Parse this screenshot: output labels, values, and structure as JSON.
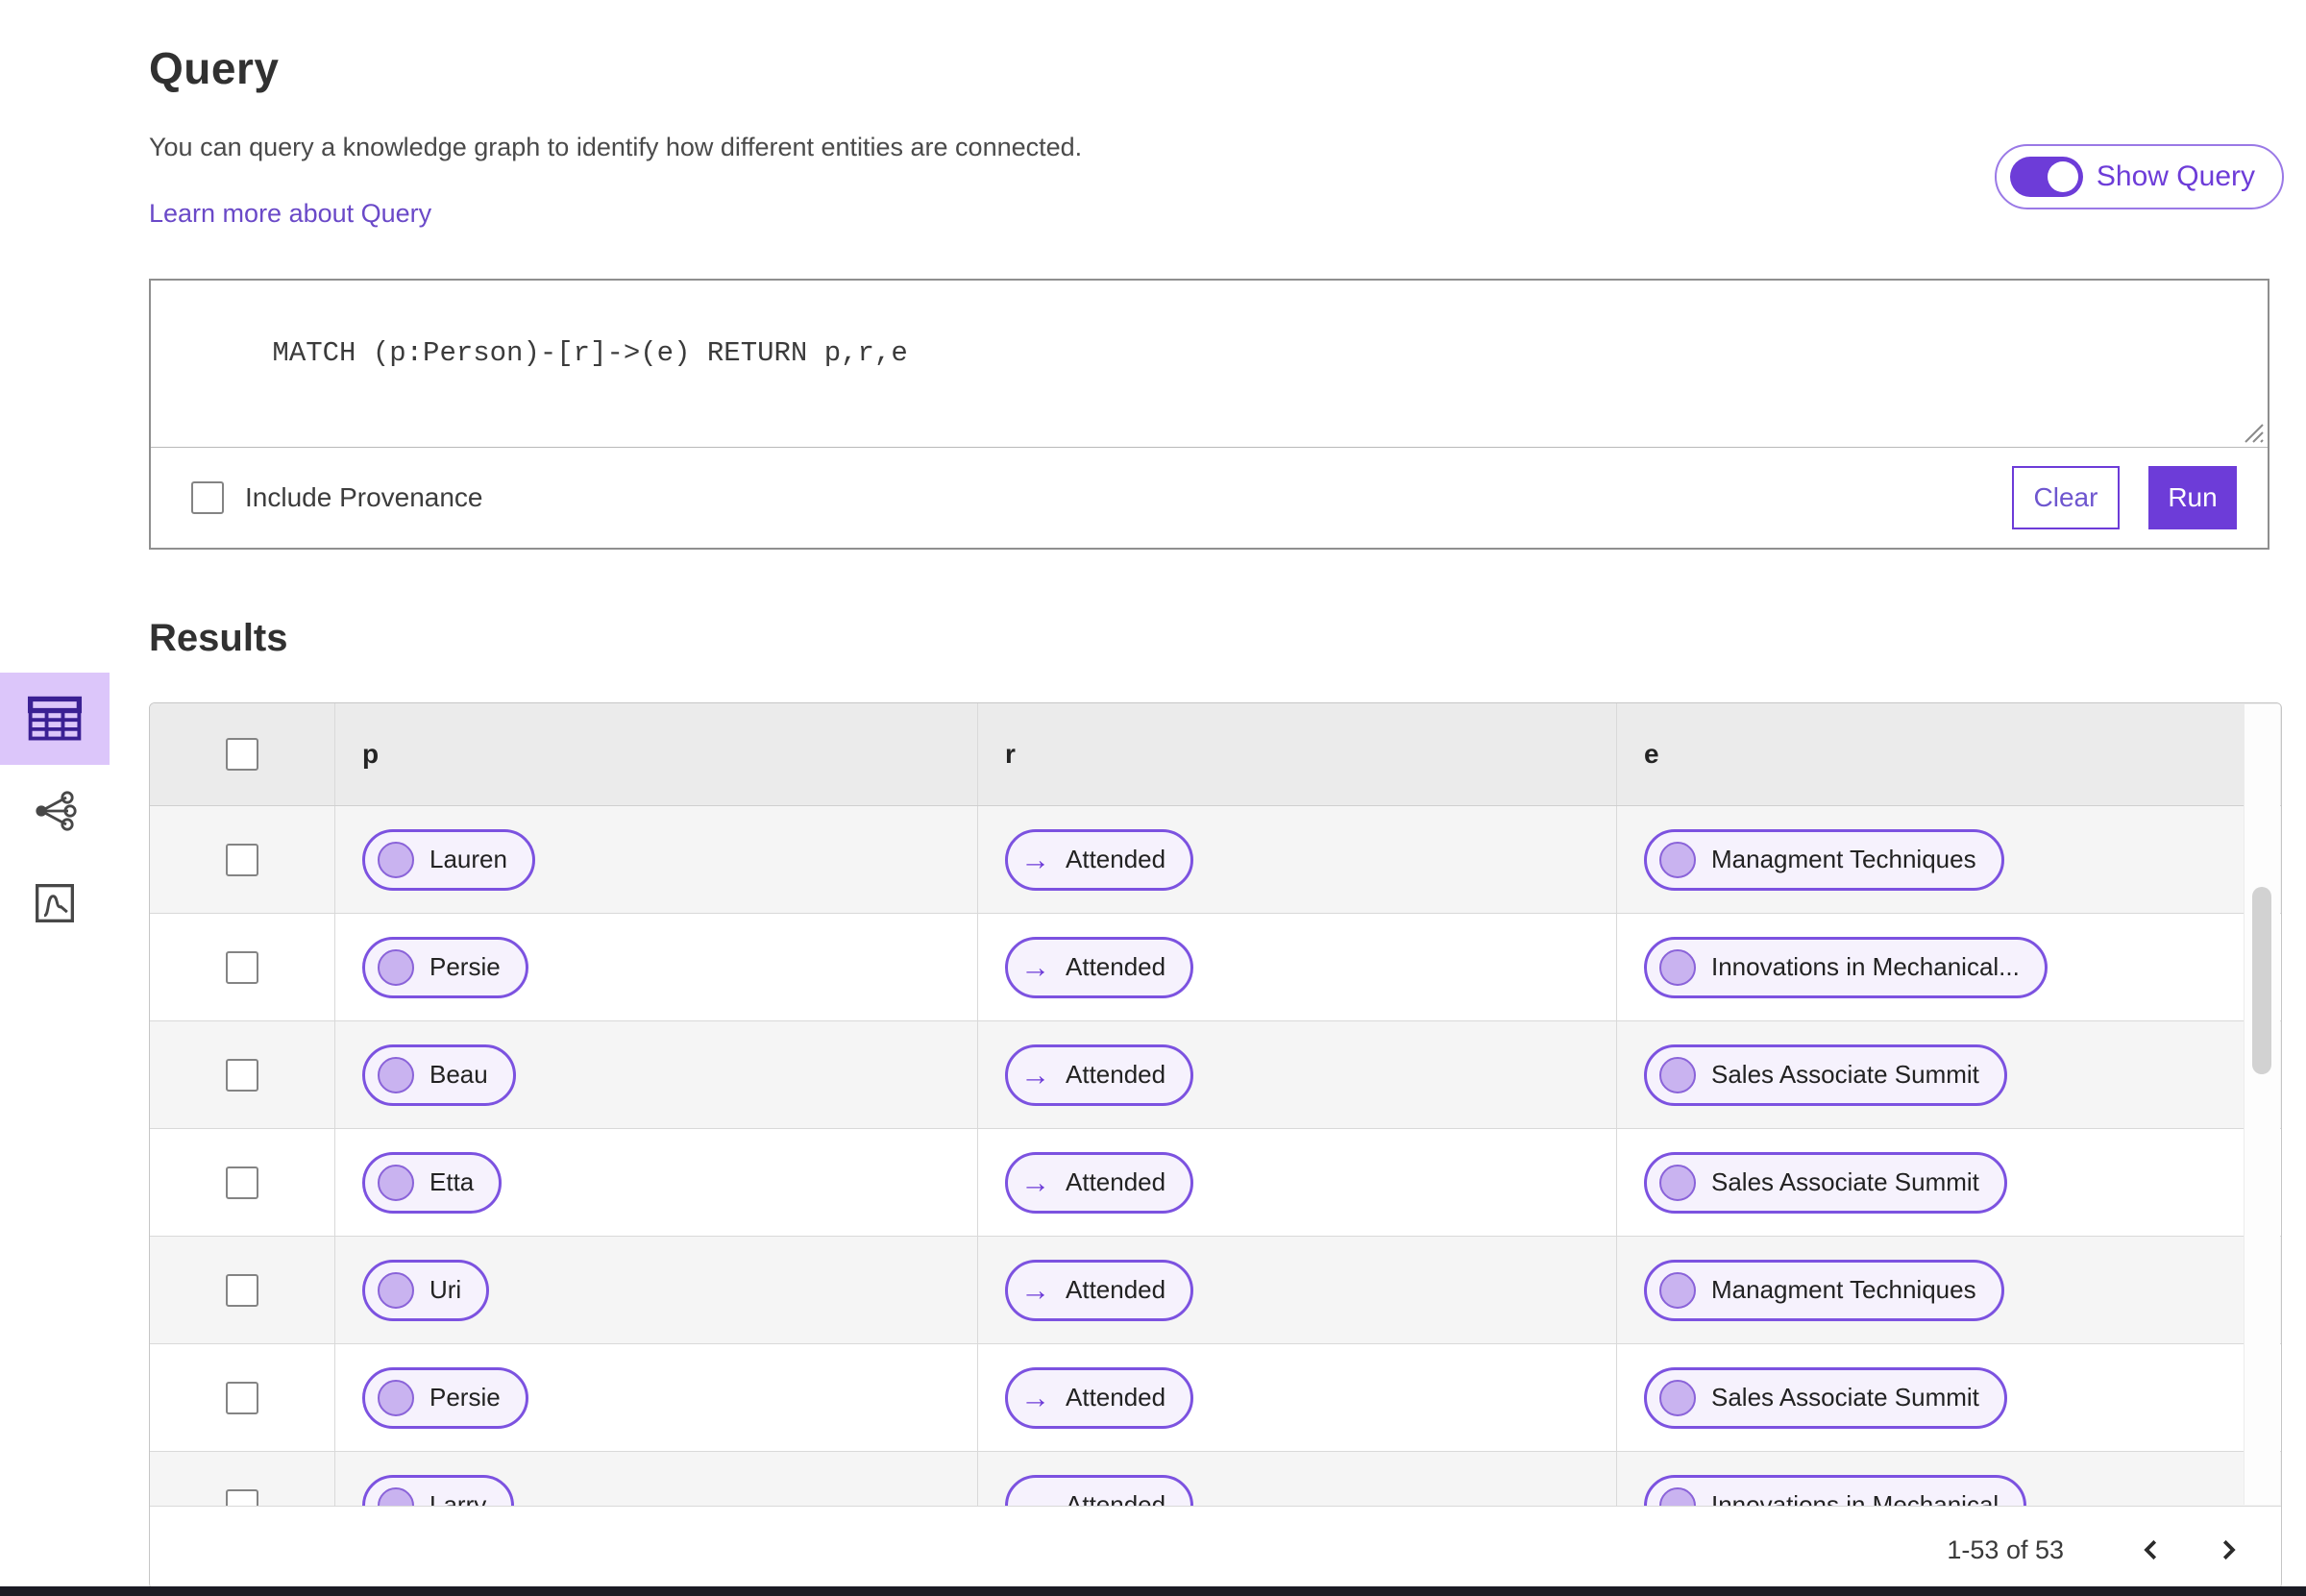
{
  "header": {
    "title": "Query",
    "description": "You can query a knowledge graph to identify how different entities are connected.",
    "learn_more_link": "Learn more about Query",
    "show_query_toggle": {
      "label": "Show Query",
      "state": "on"
    }
  },
  "query_editor": {
    "query_text": "MATCH (p:Person)-[r]->(e) RETURN p,r,e",
    "include_provenance": {
      "label": "Include Provenance",
      "checked": false
    },
    "clear_button": "Clear",
    "run_button": "Run"
  },
  "results": {
    "title": "Results",
    "view_switcher": [
      {
        "id": "table-view",
        "icon": "table-icon",
        "selected": true
      },
      {
        "id": "graph-view",
        "icon": "graph-icon",
        "selected": false
      },
      {
        "id": "chart-view",
        "icon": "chart-icon",
        "selected": false
      }
    ],
    "table": {
      "columns": [
        "p",
        "r",
        "e"
      ],
      "rows": [
        {
          "p": "Lauren",
          "r": "Attended",
          "e": "Managment Techniques"
        },
        {
          "p": "Persie",
          "r": "Attended",
          "e": "Innovations in Mechanical..."
        },
        {
          "p": "Beau",
          "r": "Attended",
          "e": "Sales Associate Summit"
        },
        {
          "p": "Etta",
          "r": "Attended",
          "e": "Sales Associate Summit"
        },
        {
          "p": "Uri",
          "r": "Attended",
          "e": "Managment Techniques"
        },
        {
          "p": "Persie",
          "r": "Attended",
          "e": "Sales Associate Summit"
        },
        {
          "p": "Larry",
          "r": "Attended",
          "e": "Innovations in Mechanical"
        }
      ]
    },
    "pagination": {
      "range_text": "1-53 of 53"
    }
  },
  "icons": {
    "edge_arrow": "→"
  },
  "colors": {
    "accent": "#6d3cd8",
    "accent-border": "#7c52e0",
    "pill-bg": "#f6f2fd",
    "pill-circle": "#c9b3f0",
    "selected-tab-bg": "#dcc6fa",
    "link": "#6a49c8"
  }
}
